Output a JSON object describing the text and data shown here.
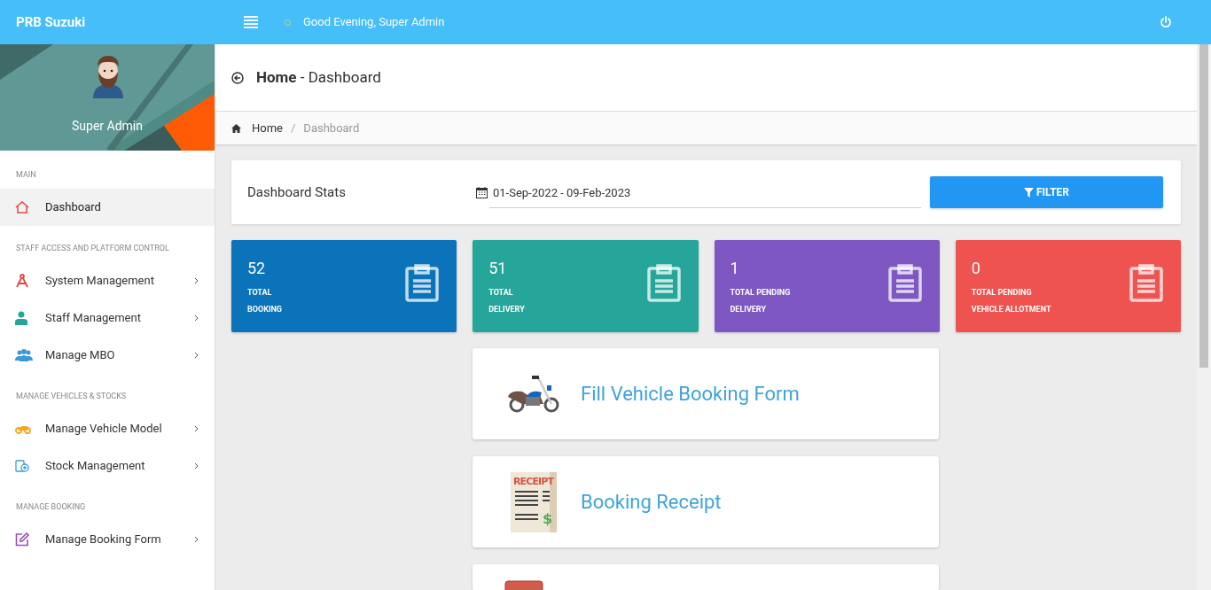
{
  "topbar": {
    "brand": "PRB Suzuki",
    "greeting": "Good Evening, Super Admin"
  },
  "profile": {
    "name": "Super Admin"
  },
  "sidebar": {
    "sections": [
      {
        "label": "MAIN",
        "items": [
          {
            "label": "Dashboard",
            "kind": "home",
            "selected": true,
            "expandable": false
          }
        ]
      },
      {
        "label": "STAFF ACCESS AND PLATFORM CONTROL",
        "items": [
          {
            "label": "System Management",
            "kind": "compass",
            "selected": false,
            "expandable": true
          },
          {
            "label": "Staff Management",
            "kind": "staff",
            "selected": false,
            "expandable": true
          },
          {
            "label": "Manage MBO",
            "kind": "group",
            "selected": false,
            "expandable": true
          }
        ]
      },
      {
        "label": "MANAGE VEHICLES & STOCKS",
        "items": [
          {
            "label": "Manage Vehicle Model",
            "kind": "bike",
            "selected": false,
            "expandable": true
          },
          {
            "label": "Stock Management",
            "kind": "stock",
            "selected": false,
            "expandable": true
          }
        ]
      },
      {
        "label": "MANAGE BOOKING",
        "items": [
          {
            "label": "Manage Booking Form",
            "kind": "edit",
            "selected": false,
            "expandable": true
          }
        ]
      }
    ]
  },
  "page_header": {
    "title": "Home",
    "subtitle": "- Dashboard"
  },
  "breadcrumb": {
    "separator": "/",
    "items": [
      {
        "label": "Home",
        "current": false
      },
      {
        "label": "Dashboard",
        "current": true
      }
    ]
  },
  "stats_panel": {
    "title": "Dashboard Stats",
    "date_range": "01-Sep-2022 - 09-Feb-2023",
    "button": "FILTER"
  },
  "stat_cards": [
    {
      "value": "52",
      "lines": [
        "TOTAL",
        "BOOKING"
      ],
      "color": "#0a73b9"
    },
    {
      "value": "51",
      "lines": [
        "TOTAL",
        "DELIVERY"
      ],
      "color": "#26a69a"
    },
    {
      "value": "1",
      "lines": [
        "TOTAL PENDING",
        "DELIVERY"
      ],
      "color": "#7e57c2"
    },
    {
      "value": "0",
      "lines": [
        "TOTAL PENDING",
        "VEHICLE ALLOTMENT"
      ],
      "color": "#ef5350"
    }
  ],
  "action_cards": [
    {
      "kind": "motorcycle",
      "title": "Fill Vehicle Booking Form"
    },
    {
      "kind": "receipt",
      "title": "Booking Receipt",
      "icon_texts": [
        "RECEIPT",
        "$"
      ]
    },
    {
      "kind": "folder"
    }
  ]
}
